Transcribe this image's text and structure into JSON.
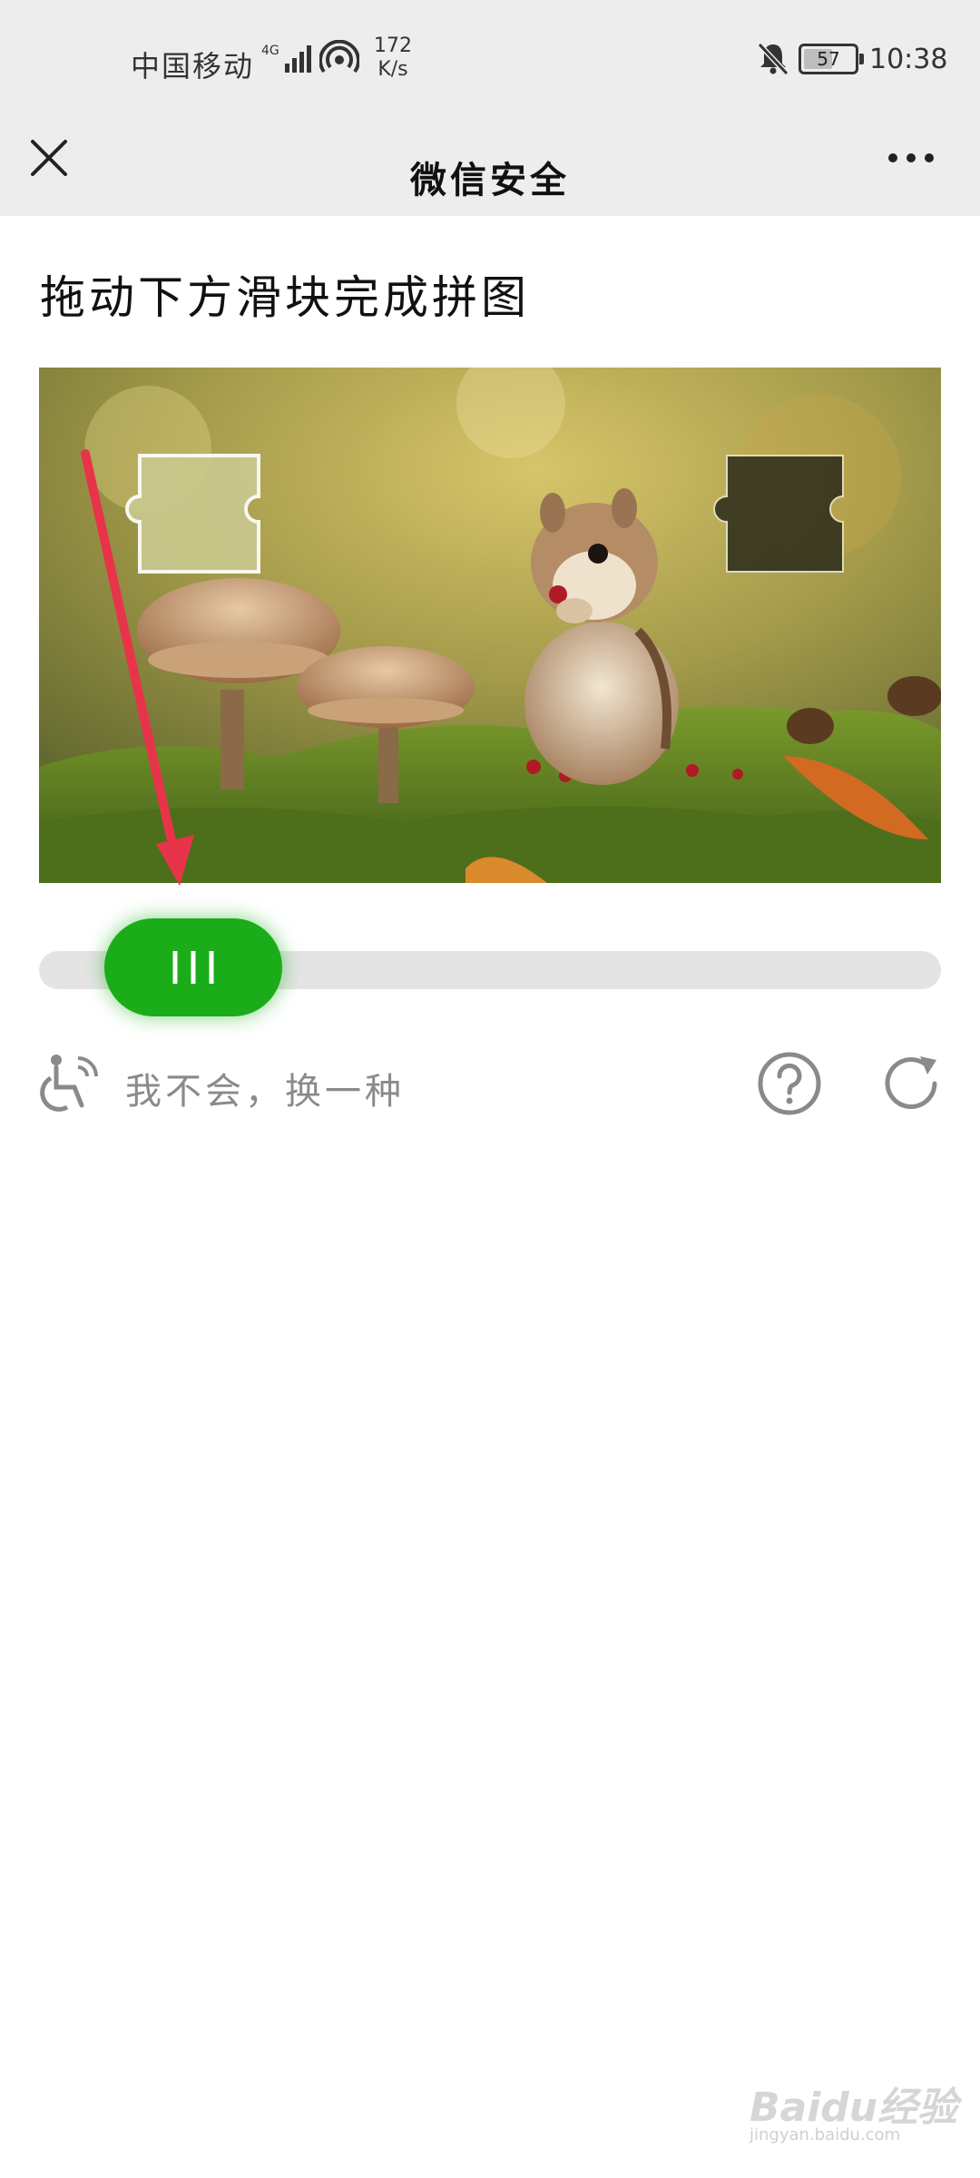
{
  "status_bar": {
    "carrier": "中国移动",
    "network_type": "4G",
    "speed_value": "172",
    "speed_unit": "K/s",
    "battery_level": "57",
    "time": "10:38",
    "icons": [
      "signal-icon",
      "hotspot-icon",
      "mute-bell-icon",
      "battery-icon"
    ]
  },
  "nav": {
    "title": "微信安全",
    "close_icon": "close-icon",
    "more_icon": "more-icon"
  },
  "captcha": {
    "instruction": "拖动下方滑块完成拼图",
    "slider_progress": 0.09,
    "alt_option": "我不会，换一种",
    "icons": [
      "accessibility-icon",
      "help-icon",
      "refresh-icon"
    ]
  },
  "colors": {
    "accent_green": "#1aad19",
    "nav_background": "#ededed",
    "annotation_arrow": "#e8344a"
  },
  "watermark": {
    "logo": "Baidu经验",
    "url": "jingyan.baidu.com"
  }
}
